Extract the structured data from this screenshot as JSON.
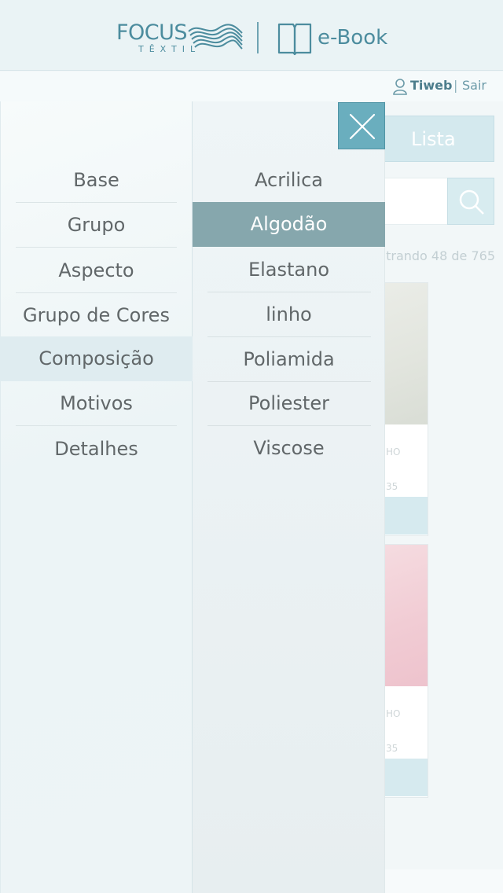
{
  "header": {
    "logo_text": "FOCUS",
    "logo_subtext": "TÊXTIL",
    "ebook_label": "e-Book"
  },
  "userbar": {
    "username": "Tiweb",
    "separator": "|",
    "logout_label": "Sair"
  },
  "background_page": {
    "list_button_label": "Lista",
    "count_text": "trando 48 de 765",
    "cards": [
      {
        "ref": "HO",
        "num": "35"
      },
      {
        "ref": "HO",
        "num": "35"
      }
    ]
  },
  "categories": [
    {
      "label": "Base"
    },
    {
      "label": "Grupo"
    },
    {
      "label": "Aspecto"
    },
    {
      "label": "Grupo de Cores"
    },
    {
      "label": "Composição"
    },
    {
      "label": "Motivos"
    },
    {
      "label": "Detalhes"
    }
  ],
  "active_category": "Composição",
  "subcategories": [
    {
      "label": "Acrilica"
    },
    {
      "label": "Algodão"
    },
    {
      "label": "Elastano"
    },
    {
      "label": "linho"
    },
    {
      "label": "Poliamida"
    },
    {
      "label": "Poliester"
    },
    {
      "label": "Viscose"
    }
  ],
  "selected_subcategory": "Algodão",
  "colors": {
    "brand": "#4c8c9e",
    "close_button": "#6aaebe",
    "selected_item": "#86a7ad",
    "active_category": "#dfecf0"
  },
  "icons": {
    "logo": "focus-wave-logo",
    "ebook": "book-icon",
    "user": "user-icon",
    "close": "close-icon",
    "search": "search-icon"
  }
}
